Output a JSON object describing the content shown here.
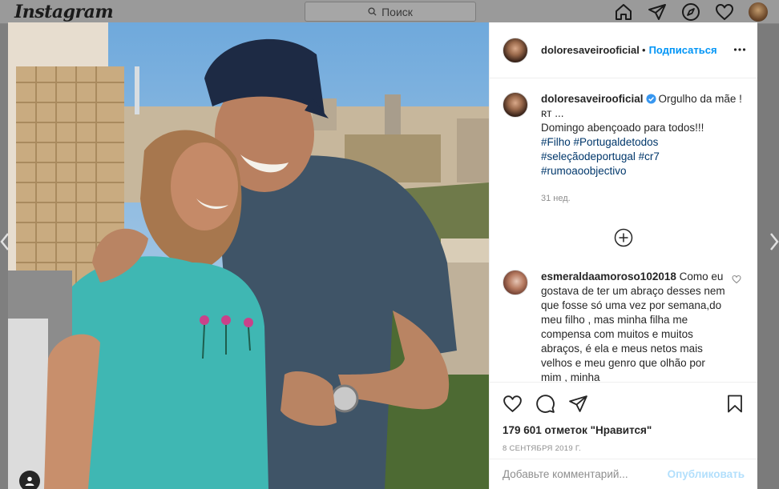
{
  "app": {
    "logo": "Instagram"
  },
  "nav": {
    "search_placeholder": "Поиск"
  },
  "post": {
    "username": "doloresaveirooficial",
    "follow_label": "Подписаться",
    "caption": {
      "username": "doloresaveirooficial",
      "text_line1": "Orgulho da mãe ! ʀᴛ ...",
      "text_line2": "Domingo abençoado para todos!!!",
      "hashtags": "#Filho #Portugaldetodos #seleçãodeportugal #cr7 #rumoaoobjectivo"
    },
    "time_ago": "31 нед.",
    "comment": {
      "username": "esmeraldaamoroso102018",
      "text": "Como eu gostava de ter um abraço desses nem que fosse só uma vez por semana,do meu filho , mas minha filha me compensa com muitos e muitos abraços, é ela e meus netos mais velhos e meu genro que olhão por mim , minha"
    },
    "likes": "179 601 отметок \"Нравится\"",
    "date": "8 СЕНТЯБРЯ 2019 Г.",
    "add_comment_placeholder": "Добавьте комментарий...",
    "publish_label": "Опубликовать"
  },
  "icons": {
    "nav": [
      "home-icon",
      "direct-icon",
      "explore-icon",
      "activity-heart-icon",
      "profile-avatar"
    ],
    "actions": [
      "like-icon",
      "comment-icon",
      "share-icon",
      "save-icon"
    ]
  },
  "colors": {
    "accent": "#0095f6",
    "hashtag": "#00376b",
    "muted": "#8e8e8e",
    "post_disabled": "#b2dffc"
  }
}
